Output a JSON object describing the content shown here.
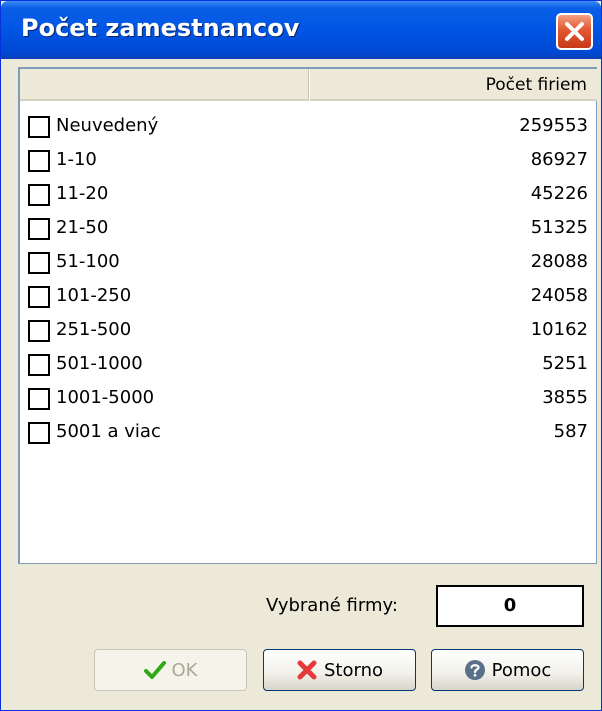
{
  "window": {
    "title": "Počet zamestnancov"
  },
  "list": {
    "column_header": "Počet firiem",
    "rows": [
      {
        "label": "Neuvedený",
        "count": "259553",
        "checked": false
      },
      {
        "label": "1-10",
        "count": "86927",
        "checked": false
      },
      {
        "label": "11-20",
        "count": "45226",
        "checked": false
      },
      {
        "label": "21-50",
        "count": "51325",
        "checked": false
      },
      {
        "label": "51-100",
        "count": "28088",
        "checked": false
      },
      {
        "label": "101-250",
        "count": "24058",
        "checked": false
      },
      {
        "label": "251-500",
        "count": "10162",
        "checked": false
      },
      {
        "label": "501-1000",
        "count": "5251",
        "checked": false
      },
      {
        "label": "1001-5000",
        "count": "3855",
        "checked": false
      },
      {
        "label": "5001 a viac",
        "count": "587",
        "checked": false
      }
    ]
  },
  "footer": {
    "selected_label": "Vybrané firmy:",
    "selected_value": "0"
  },
  "buttons": {
    "ok_label": "OK",
    "storno_label": "Storno",
    "pomoc_label": "Pomoc"
  },
  "icons": {
    "close": "close-icon",
    "ok": "checkmark-icon",
    "storno": "x-icon",
    "pomoc": "help-icon"
  },
  "colors": {
    "titlebar": "#0055e5",
    "close_button": "#e2582f",
    "ok_check": "#2fa81a",
    "storno_x": "#e63a3a",
    "help_icon": "#5a6f8a"
  }
}
